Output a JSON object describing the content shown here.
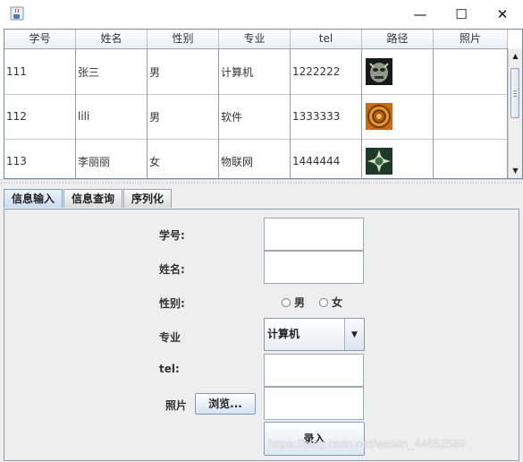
{
  "window": {
    "app_icon": "java-cup-icon",
    "controls": {
      "minimize": "—",
      "maximize": "☐",
      "close": "✕"
    }
  },
  "table": {
    "columns": [
      "学号",
      "姓名",
      "性别",
      "专业",
      "tel",
      "路径",
      "照片"
    ],
    "rows": [
      {
        "id": "111",
        "name": "张三",
        "gender": "男",
        "major": "计算机",
        "tel": "1222222",
        "path_icon": "tribal-mask-image",
        "photo": ""
      },
      {
        "id": "112",
        "name": "lili",
        "gender": "男",
        "major": "软件",
        "tel": "1333333",
        "path_icon": "aztec-sun-image",
        "photo": ""
      },
      {
        "id": "113",
        "name": "李丽丽",
        "gender": "女",
        "major": "物联网",
        "tel": "1444444",
        "path_icon": "mandala-image",
        "photo": ""
      }
    ],
    "scroll_position": 0.1
  },
  "tabs": [
    {
      "label": "信息输入",
      "active": true
    },
    {
      "label": "信息查询",
      "active": false
    },
    {
      "label": "序列化",
      "active": false
    }
  ],
  "form": {
    "student_id_label": "学号:",
    "student_id_value": "",
    "name_label": "姓名:",
    "name_value": "",
    "gender_label": "性别:",
    "gender_male": "男",
    "gender_female": "女",
    "major_label": "专业",
    "major_selected": "计算机",
    "tel_label": "tel:",
    "tel_value": "",
    "photo_label": "照片",
    "browse_label": "浏览...",
    "photo_value": "",
    "submit_label": "录入"
  },
  "watermark": "https://blog.csdn.net/weixin_44652589",
  "colors": {
    "tab_active": "#c9dcf0",
    "panel_border": "#8aa1b7",
    "background": "#eeeeee"
  }
}
